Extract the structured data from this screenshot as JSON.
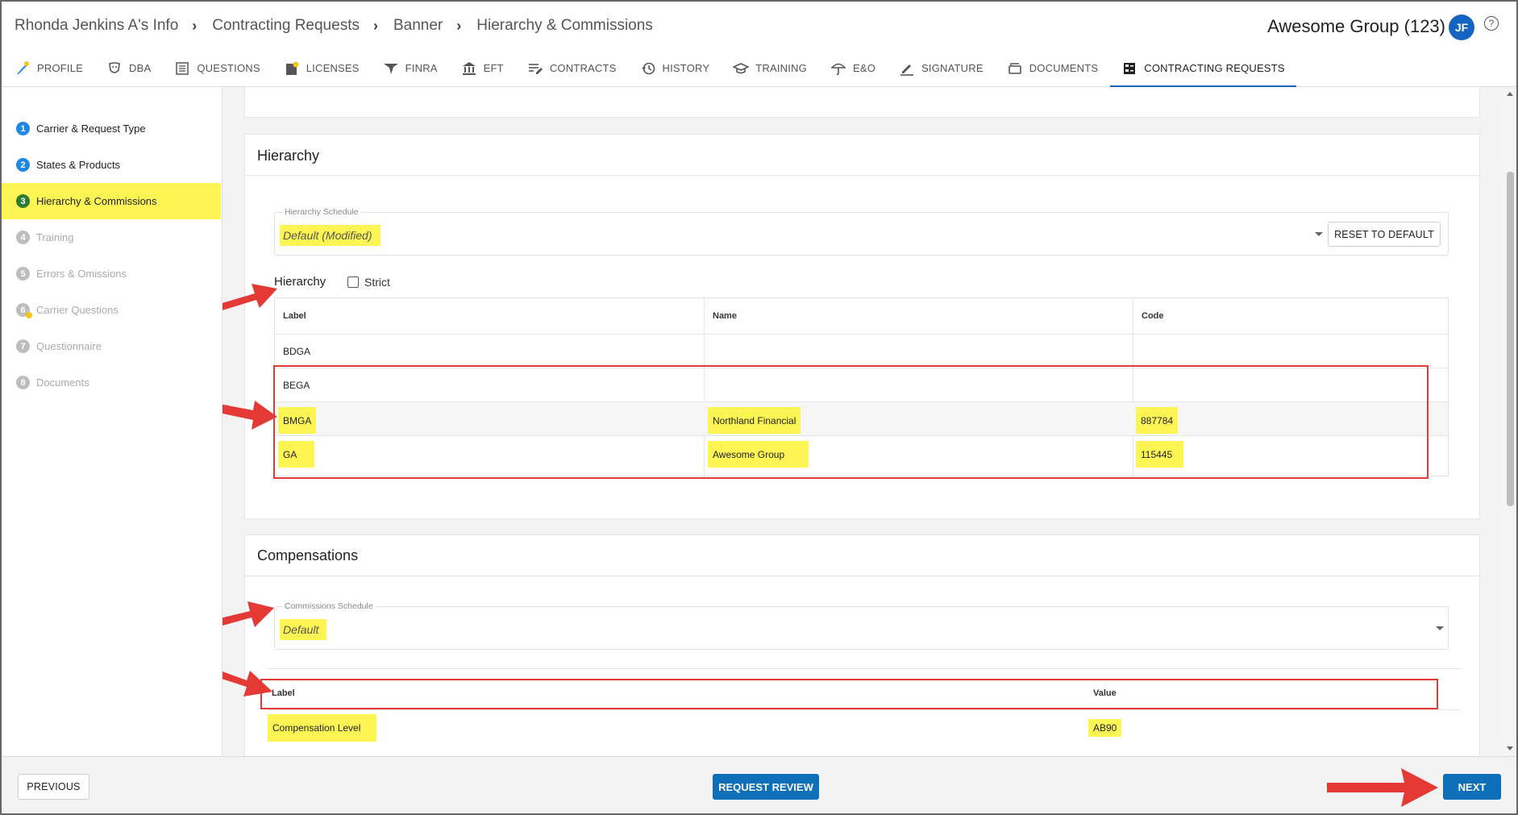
{
  "breadcrumb": [
    "Rhonda Jenkins A's Info",
    "Contracting Requests",
    "Banner",
    "Hierarchy & Commissions"
  ],
  "header": {
    "account": "Awesome Group (123)",
    "avatar_initials": "JF",
    "help_icon": "?"
  },
  "tabs": [
    {
      "label": "PROFILE",
      "icon": "profile-icon"
    },
    {
      "label": "DBA",
      "icon": "mask-icon"
    },
    {
      "label": "QUESTIONS",
      "icon": "list-icon"
    },
    {
      "label": "LICENSES",
      "icon": "license-icon"
    },
    {
      "label": "FINRA",
      "icon": "finra-icon"
    },
    {
      "label": "EFT",
      "icon": "bank-icon"
    },
    {
      "label": "CONTRACTS",
      "icon": "edit-list-icon"
    },
    {
      "label": "HISTORY",
      "icon": "history-icon"
    },
    {
      "label": "TRAINING",
      "icon": "graduation-cap-icon"
    },
    {
      "label": "E&O",
      "icon": "umbrella-icon"
    },
    {
      "label": "SIGNATURE",
      "icon": "pen-icon"
    },
    {
      "label": "DOCUMENTS",
      "icon": "documents-icon"
    },
    {
      "label": "CONTRACTING REQUESTS",
      "icon": "contracting-icon",
      "active": true
    }
  ],
  "steps": [
    {
      "num": "1",
      "label": "Carrier & Request Type"
    },
    {
      "num": "2",
      "label": "States & Products"
    },
    {
      "num": "3",
      "label": "Hierarchy & Commissions"
    },
    {
      "num": "4",
      "label": "Training"
    },
    {
      "num": "5",
      "label": "Errors & Omissions"
    },
    {
      "num": "6",
      "label": "Carrier Questions"
    },
    {
      "num": "7",
      "label": "Questionnaire"
    },
    {
      "num": "8",
      "label": "Documents"
    }
  ],
  "hierarchy": {
    "title": "Hierarchy",
    "schedule_label": "Hierarchy Schedule",
    "schedule_value": "Default  (Modified)",
    "reset_label": "RESET TO DEFAULT",
    "sub_title": "Hierarchy",
    "strict_label": "Strict",
    "columns": [
      "Label",
      "Name",
      "Code"
    ],
    "rows": [
      {
        "label": "BDGA",
        "name": "",
        "code": ""
      },
      {
        "label": "BEGA",
        "name": "",
        "code": ""
      },
      {
        "label": "BMGA",
        "name": "Northland Financial",
        "code": "887784"
      },
      {
        "label": "GA",
        "name": "Awesome Group",
        "code": "115445"
      }
    ]
  },
  "compensations": {
    "title": "Compensations",
    "schedule_label": "Commissions Schedule",
    "schedule_value": "Default",
    "columns": [
      "Label",
      "Value"
    ],
    "rows": [
      {
        "label": "Compensation Level",
        "value": "AB90"
      }
    ]
  },
  "footer": {
    "previous": "PREVIOUS",
    "request_review": "REQUEST REVIEW",
    "next": "NEXT"
  },
  "colors": {
    "highlight": "#fdf554",
    "primary": "#0d6fb8",
    "annotation_red": "#e53935"
  }
}
